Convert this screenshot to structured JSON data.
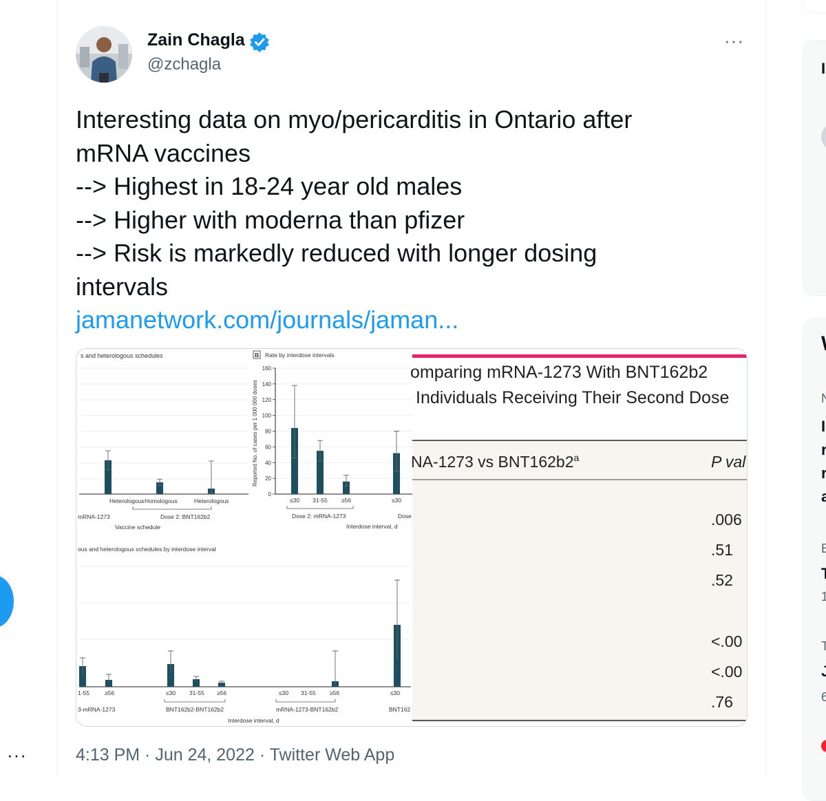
{
  "tweet": {
    "author_name": "Zain Chagla",
    "handle": "@zchagla",
    "text_lines": [
      "Interesting data on myo/pericarditis in Ontario after",
      "mRNA vaccines",
      "--> Highest in 18-24 year old males",
      "--> Higher with moderna than pfizer",
      "--> Risk is markedly reduced with longer dosing",
      "intervals"
    ],
    "link": "jamanetwork.com/journals/jaman...",
    "timestamp": "4:13 PM · Jun 24, 2022 · Twitter Web App",
    "more_label": "···"
  },
  "left_rail": {
    "more_label": "···"
  },
  "colors": {
    "accent": "#1d9bf0",
    "bar": "#1e4f60",
    "table_accent": "#e5246b"
  },
  "media": {
    "panel_a_title": "s and heterologous schedules",
    "panel_b_letter": "B",
    "panel_b_title": "Rate by interdose intervals",
    "panel_c_title": "ous and heterologous schedules by interdose interval",
    "y_axis_label": "Reported No. of cases per 1 000 000 doses",
    "y_ticks": [
      "160",
      "140",
      "120",
      "100",
      "80",
      "60",
      "40",
      "20",
      "0"
    ],
    "schedule_labels": [
      "Heterologous",
      "Homologous",
      "Heterologous"
    ],
    "dose_label_a": "mRNA-1273",
    "dose_label_b": "Dose 2: BNT162b2",
    "vaccine_schedule_label": "Vaccine schedule",
    "interval_labels": [
      "≤30",
      "31-55",
      "≥56",
      "≤30"
    ],
    "dose2_mrna_label": "Dose 2: mRNA-1273",
    "dose_cut_label": "Dose",
    "interdose_label": "Interdose interval, d",
    "bottom_tick_labels": [
      "1-55",
      "≥56",
      "≤30",
      "31-55",
      "≥56",
      "≤30",
      "31-55",
      "≥56",
      "≤30"
    ],
    "bottom_group_labels": [
      "3-mRNA-1273",
      "BNT162b2-BNT162b2",
      "mRNA-1273-BNT162b2",
      "BNT162"
    ],
    "bottom_interdose_label": "Interdose interval, d",
    "table_title_1": "omparing mRNA-1273 With BNT162b2",
    "table_title_2": "Individuals Receiving Their Second Dose",
    "table_col_1": "NA-1273 vs BNT162b2",
    "table_col_1_sup": "a",
    "table_col_2": "P val",
    "table_pvalues": [
      ".006",
      ".51",
      ".52",
      "<.00",
      "<.00",
      ".76"
    ]
  },
  "chart_data": [
    {
      "type": "bar",
      "title": "Rate by interdose intervals",
      "ylabel": "Reported No. of cases per 1 000 000 doses",
      "xlabel": "Interdose interval, d",
      "ylim": [
        0,
        160
      ],
      "categories": [
        "≤30",
        "31-55",
        "≥56",
        "≤30"
      ],
      "values": [
        84,
        55,
        16,
        52
      ],
      "error_low": [
        46,
        42,
        10,
        29
      ],
      "error_high": [
        138,
        68,
        24,
        80
      ]
    },
    {
      "type": "bar",
      "title": "s and heterologous schedules",
      "xlabel": "Vaccine schedule",
      "categories": [
        "Heterologous",
        "Homologous",
        "Heterologous"
      ],
      "values": [
        43,
        15,
        7
      ],
      "error_low": [
        31,
        11,
        1
      ],
      "error_high": [
        55,
        19,
        42
      ]
    }
  ],
  "sidebar": {
    "partial_letters": [
      "I",
      "W",
      "N",
      "I",
      "r",
      "r",
      "a",
      "E",
      "T",
      "1",
      "T",
      "J",
      "6"
    ]
  }
}
